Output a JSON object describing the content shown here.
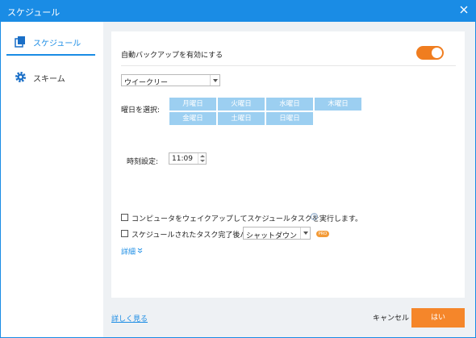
{
  "window": {
    "title": "スケジュール"
  },
  "sidebar": {
    "items": [
      {
        "label": "スケジュール",
        "icon": "copy-icon",
        "active": true
      },
      {
        "label": "スキーム",
        "icon": "gear-icon",
        "active": false
      }
    ]
  },
  "main": {
    "auto_backup_label": "自動バックアップを有効にする",
    "auto_backup_enabled": true,
    "frequency_select": {
      "value": "ウイークリー"
    },
    "day_select_label": "曜日を選択:",
    "days": [
      "月曜日",
      "火曜日",
      "水曜日",
      "木曜日",
      "金曜日",
      "土曜日",
      "日曜日"
    ],
    "time_label": "時刻設定:",
    "time_value": "11:09",
    "wake_computer_label": "コンピュータをウェイクアップしてスケジュールタスクを実行します。",
    "wake_computer_checked": false,
    "after_task_label": "スケジュールされたタスク完了後パソコン",
    "after_task_checked": false,
    "after_task_select": {
      "value": "シャットダウン"
    },
    "pro_badge": "PRO",
    "details_label": "詳細"
  },
  "footer": {
    "learn_more": "詳しく見る",
    "cancel": "キャンセル",
    "ok": "はい"
  },
  "colors": {
    "titlebar": "#1a8ce5",
    "accent_orange": "#f5862a",
    "day_button": "#9ccff1",
    "link": "#1a8ce5"
  }
}
